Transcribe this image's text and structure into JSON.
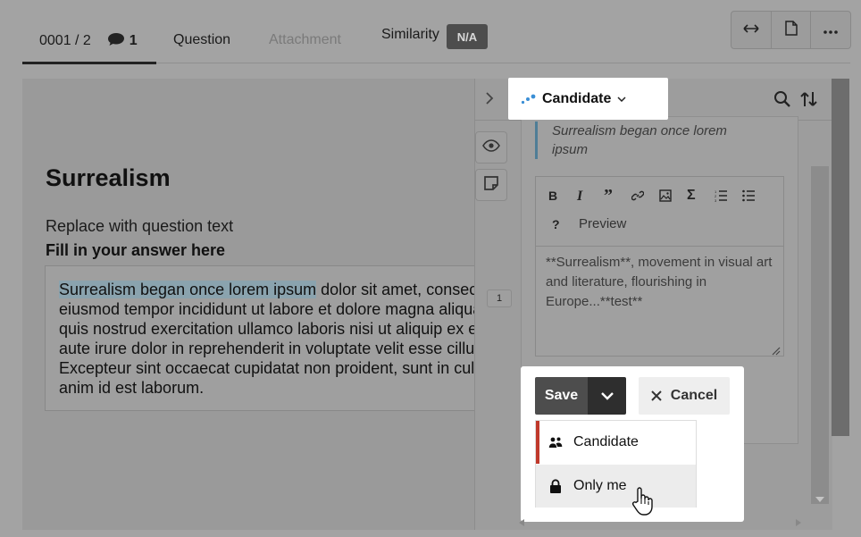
{
  "tabs": {
    "counter": "0001 / 2",
    "comment_count": "1",
    "question": "Question",
    "attachment": "Attachment",
    "similarity": "Similarity",
    "similarity_badge": "N/A"
  },
  "toolbar": {
    "icons": [
      "swap-horizontal-icon",
      "document-icon",
      "more-icon"
    ]
  },
  "question": {
    "title": "Surrealism",
    "text": "Replace with question text",
    "fill_label": "Fill in your answer here",
    "answer_highlight": "Surrealism began once lorem ipsum",
    "answer_line1_rest": " dolor sit amet, consectetur adipiscing elit, sed do",
    "answer_lines": [
      "eiusmod tempor incididunt ut labore et dolore magna aliqua.",
      "quis nostrud exercitation ullamco laboris nisi ut aliquip ex ea",
      "aute irure dolor in reprehenderit in voluptate velit esse cillum",
      "Excepteur sint occaecat cupidatat non proident, sunt in culpa",
      "anim id est laborum."
    ],
    "line_marker": "1"
  },
  "side_panel": {
    "audience": "Candidate",
    "quote": "Surrealism began once lorem ipsum",
    "preview_label": "Preview",
    "help_label": "?",
    "editor_text": "**Surrealism**, movement in visual art and literature, flourishing in Europe...**test**"
  },
  "actions": {
    "save": "Save",
    "cancel": "Cancel",
    "options": [
      {
        "label": "Candidate",
        "icon": "people-icon"
      },
      {
        "label": "Only me",
        "icon": "lock-icon"
      }
    ]
  },
  "colors": {
    "accent_blue": "#3a8fd6",
    "selected_marker": "#c0392b"
  }
}
